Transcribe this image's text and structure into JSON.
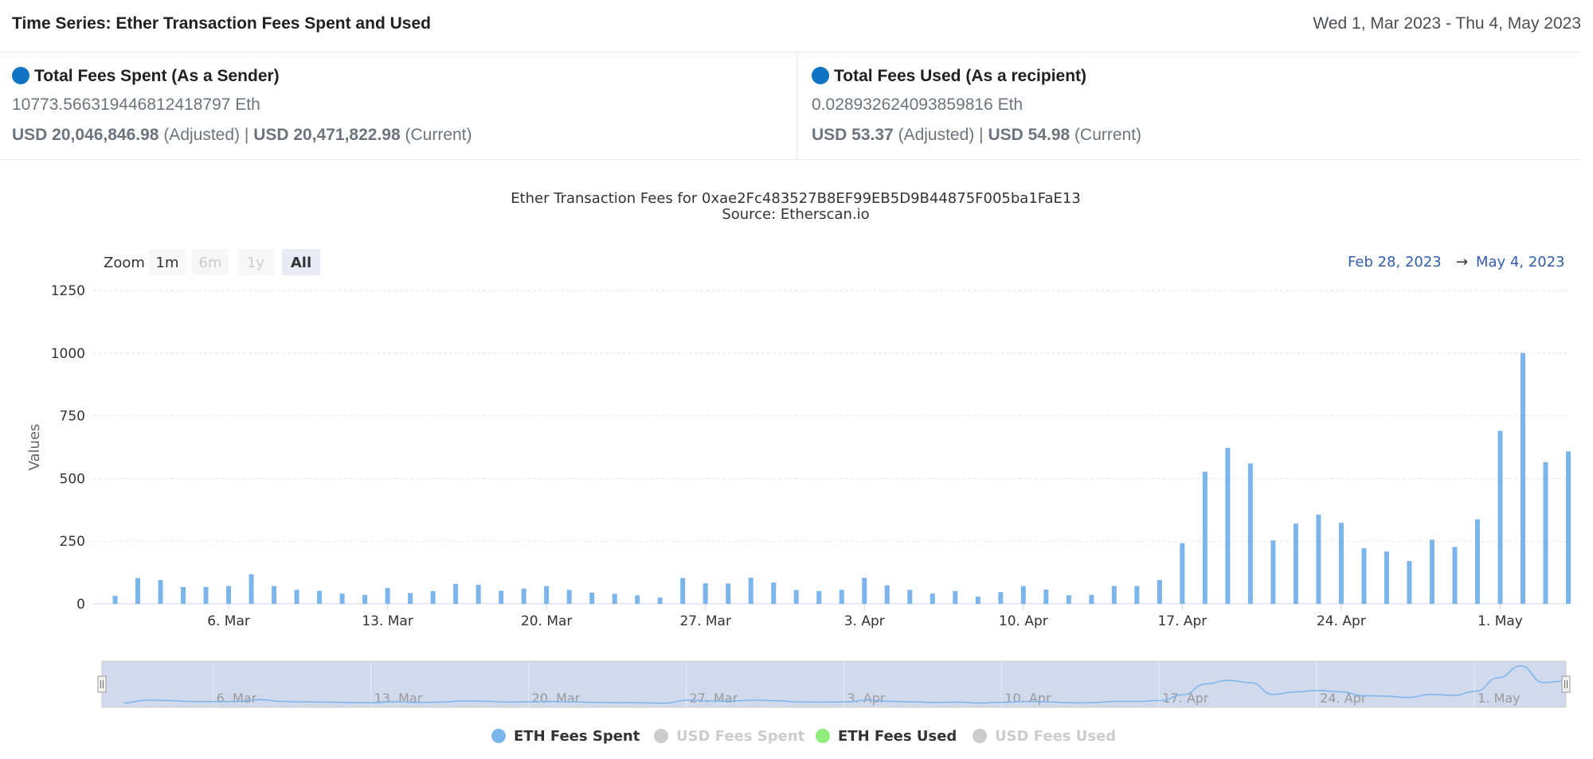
{
  "header": {
    "title": "Time Series: Ether Transaction Fees Spent and Used",
    "date_range": "Wed 1, Mar 2023 - Thu 4, May 2023"
  },
  "stats": {
    "spent": {
      "label": "Total Fees Spent (As a Sender)",
      "eth_value": "10773.566319446812418797 Eth",
      "usd_adjusted": "USD 20,046,846.98",
      "adjusted_label": "(Adjusted)",
      "separator": "|",
      "usd_current": "USD 20,471,822.98",
      "current_label": "(Current)"
    },
    "used": {
      "label": "Total Fees Used (As a recipient)",
      "eth_value": "0.028932624093859816 Eth",
      "usd_adjusted": "USD 53.37",
      "adjusted_label": "(Adjusted)",
      "separator": "|",
      "usd_current": "USD 54.98",
      "current_label": "(Current)"
    }
  },
  "zoom": {
    "label": "Zoom",
    "buttons": [
      "1m",
      "6m",
      "1y",
      "All"
    ],
    "disabled": [
      "6m",
      "1y"
    ],
    "selected": "All"
  },
  "range_selector": {
    "from": "Feb 28, 2023",
    "arrow": "→",
    "to": "May 4, 2023"
  },
  "colors": {
    "bar": "#7cb5ec",
    "dot_blue": "#1073c4",
    "eth_used": "#90ed7d",
    "disabled": "#cccccc"
  },
  "chart_data": {
    "type": "bar",
    "title": "Ether Transaction Fees for 0xae2Fc483527B8EF99EB5D9B44875F005ba1FaE13",
    "subtitle": "Source: Etherscan.io",
    "ylabel": "Values",
    "xlabel": "",
    "ylim": [
      0,
      1250
    ],
    "y_ticks": [
      0,
      250,
      500,
      750,
      1000,
      1250
    ],
    "x_range": [
      "2023-02-28",
      "2023-05-04"
    ],
    "x_ticks": [
      {
        "date": "2023-03-06",
        "label": "6. Mar"
      },
      {
        "date": "2023-03-13",
        "label": "13. Mar"
      },
      {
        "date": "2023-03-20",
        "label": "20. Mar"
      },
      {
        "date": "2023-03-27",
        "label": "27. Mar"
      },
      {
        "date": "2023-04-03",
        "label": "3. Apr"
      },
      {
        "date": "2023-04-10",
        "label": "10. Apr"
      },
      {
        "date": "2023-04-17",
        "label": "17. Apr"
      },
      {
        "date": "2023-04-24",
        "label": "24. Apr"
      },
      {
        "date": "2023-05-01",
        "label": "1. May"
      }
    ],
    "grid": true,
    "series": [
      {
        "name": "ETH Fees Spent",
        "visible": true,
        "start_date": "2023-03-01",
        "values": [
          32,
          103,
          95,
          67,
          67,
          71,
          118,
          71,
          56,
          52,
          41,
          36,
          63,
          43,
          51,
          80,
          76,
          52,
          61,
          71,
          56,
          45,
          40,
          34,
          25,
          103,
          82,
          81,
          104,
          85,
          55,
          51,
          56,
          104,
          74,
          56,
          41,
          51,
          29,
          47,
          71,
          57,
          34,
          36,
          71,
          71,
          95,
          242,
          527,
          622,
          560,
          253,
          320,
          356,
          323,
          222,
          209,
          171,
          256,
          227,
          337,
          690,
          1000,
          565,
          608
        ]
      },
      {
        "name": "USD Fees Spent",
        "visible": false
      },
      {
        "name": "ETH Fees Used",
        "visible": true
      },
      {
        "name": "USD Fees Used",
        "visible": false
      }
    ],
    "legend_position": "bottom-center"
  }
}
